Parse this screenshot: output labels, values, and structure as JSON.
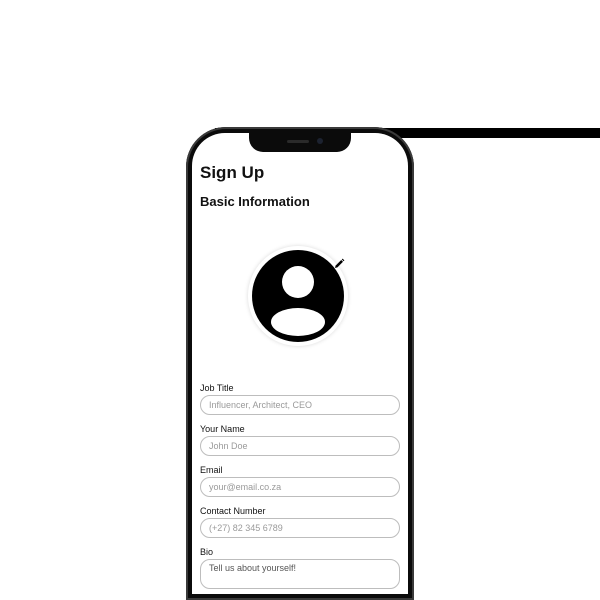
{
  "header": {
    "title": "Sign Up",
    "section": "Basic Information"
  },
  "avatar": {
    "icon": "user-avatar-icon",
    "edit_icon": "pencil-icon"
  },
  "form": {
    "job_title": {
      "label": "Job Title",
      "placeholder": "Influencer, Architect, CEO",
      "value": ""
    },
    "name": {
      "label": "Your Name",
      "placeholder": "John Doe",
      "value": ""
    },
    "email": {
      "label": "Email",
      "placeholder": "your@email.co.za",
      "value": ""
    },
    "contact": {
      "label": "Contact Number",
      "placeholder": "(+27) 82 345 6789",
      "value": ""
    },
    "bio": {
      "label": "Bio",
      "placeholder": "Tell us about yourself!",
      "value": ""
    }
  },
  "colors": {
    "accent": "#000000",
    "field_border": "#bdbdbd",
    "placeholder": "#9a9a9a"
  }
}
